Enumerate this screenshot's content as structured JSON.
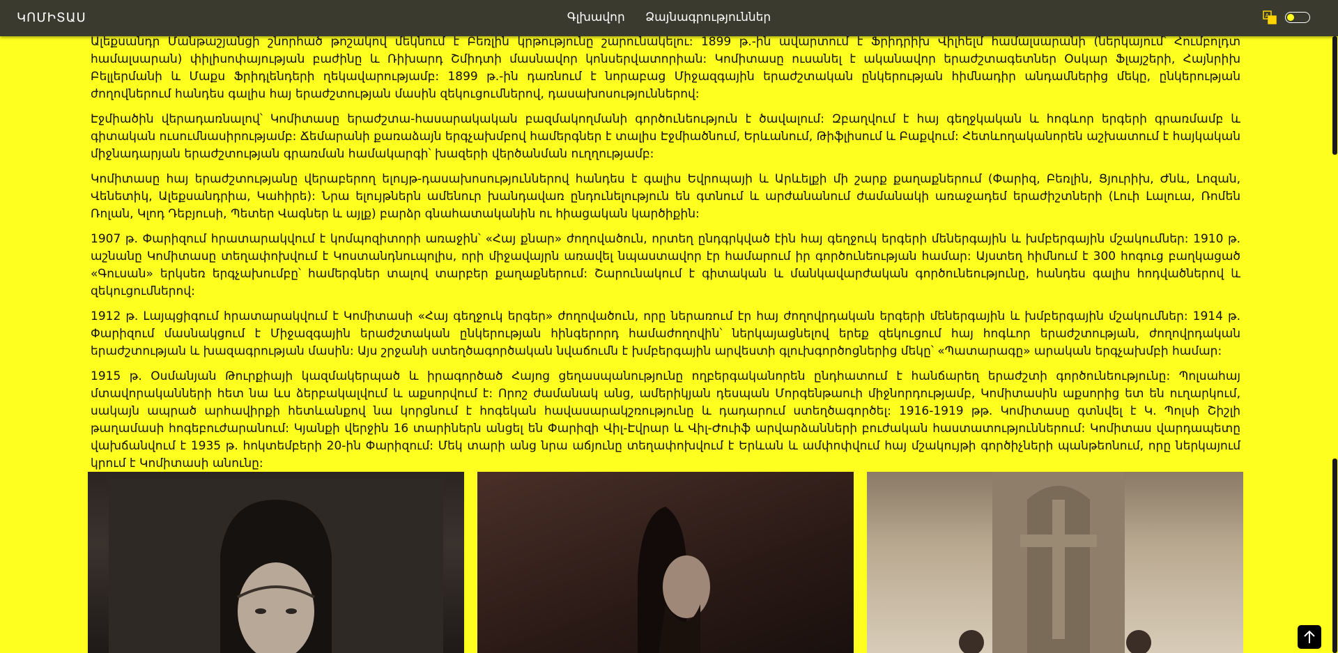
{
  "navbar": {
    "brand": "ԿՈՄԻՏԱՍ",
    "links": [
      "Գլխավոր",
      "Ձայնագրություններ"
    ],
    "translate_icon": "translate-icon",
    "theme_toggle_icon": "toggle-switch"
  },
  "paragraphs": [
    "Ալեքսանդր Մանթաշյանցի շնորհած թոշակով մեկնում է Բեռլին կրթությունը շարունակելու: 1899 թ.-ին ավարտում է Ֆրիդրիխ Վիլհելմ համալսարանի (ներկայում՝ Հումբոլդտ համալսարան) փիլիսոփայության բաժինը և Ռիխարդ Շմիդտի մասնավոր կոնսերվատորիան: Կոմիտասը ուսանել է ականավոր երաժշտագետներ Օսկար Ֆլայշերի, Հայնրիխ Բելլերմանի և Մաքս Ֆրիդլենդերի ղեկավարությամբ: 1899 թ.-ին դառնում է նորաբաց Միջազգային երաժշտական ընկերության հիմնադիր անդամներից մեկը, ընկերության ժողովներում հանդես գալիս հայ երաժշտության մասին զեկուցումներով, դասախոսություններով:",
    "Էջմիածին վերադառնալով՝ Կոմիտասը երաժշտա-հասարակական բազմակողմանի գործունեություն է ծավալում: Զբաղվում է հայ գեղջկական և հոգևոր երգերի գրառմամբ և գիտական ուսումնասիրությամբ: Ճեմարանի քառաձայն երգչախմբով համերգներ է տալիս Էջմիածնում, Երևանում, Թիֆլիսում և Բաքվում: Հետևողականորեն աշխատում է հայկական միջնադարյան երաժշտության գրառման համակարգի՝ խազերի վերծանման ուղղությամբ:",
    "Կոմիտասը հայ երաժշտությանը վերաբերող ելույթ-դասախոսություններով հանդես է գալիս Եվրոպայի և Արևելքի մի շարք քաղաքներում (Փարիզ, Բեռլին, Ցյուրիխ, Ժնև, Լոզան, Վենետիկ, Ալեքսանդրիա, Կահիրե): Նրա ելույթներն ամենուր խանդավառ ընդունելություն են գտնում և արժանանում ժամանակի առաջադեմ երաժիշտների (Լուի Լալուա, Ռոմեն Ռոլան, Կլոդ Դեբյուսի, Պետեր Վագներ և այլք) բարձր գնահատականին ու հիացական կարծիքին:",
    "1907 թ. Փարիզում հրատարակվում է կոմպոզիտորի առաջին՝ «Հայ քնար» ժողովածուն, որտեղ ընդգրկված էին հայ գեղջուկ երգերի մեներգային և խմբերգային մշակումներ: 1910 թ. աշնանը Կոմիտասը տեղափոխվում է Կոստանդնուպոլիս, որի միջավայրն առավել նպաստավոր էր համարում իր գործունեության համար: Այստեղ հիմնում է 300 հոգուց բաղկացած «Գուսան» երկսեռ երգչախումբը՝ համերգներ տալով տարբեր քաղաքներում: Շարունակում է գիտական և մանկավարժական գործունեությունը, հանդես գալիս հոդվածներով և զեկուցումներով:",
    "1912 թ. Լայպցիգում հրատարակվում է Կոմիտասի «Հայ գեղջուկ երգեր» ժողովածուն, որը ներառում էր հայ ժողովրդական երգերի մեներգային և խմբերգային մշակումներ: 1914 թ. Փարիզում մասնակցում է Միջազգային երաժշտական ընկերության հինգերորդ համաժողովին՝ ներկայացնելով երեք զեկուցում հայ հոգևոր երաժշտության, ժողովրդական երաժշտության և խազագրության մասին: Այս շրջանի ստեղծագործական նվաճումն է խմբերգային արվեստի գլուխգործոցներից մեկը՝ «Պատարագը» արական երգչախմբի համար:",
    "1915 թ. Օսմանյան Թուրքիայի կազմակերպած և իրագործած Հայոց ցեղասպանությունը ողբերգականորեն ընդհատում է հանճարեղ երաժշտի գործունեությունը: Պոլսահայ մտավորականների հետ նա ևս ձերբակալվում և աքսորվում է: Որոշ ժամանակ անց, ամերիկյան դեսպան Մորգենթաուի միջնորդությամբ, Կոմիտասին աքսորից ետ են ուղարկում, սակայն ապրած արհավիրքի հետևանքով նա կորցնում է հոգեկան հավասարակշռությունը և դադարում ստեղծագործել: 1916-1919 թթ. Կոմիտասը գտնվել է Կ. Պոլսի Շիշլի թաղամասի հոգեբուժարանում: Կյանքի վերջին 16 տարիներն անցել են Փարիզի Վիլ-Էվրար և Վիլ-Ժուիֆ արվարձանների բուժական հաստատություններում: Կոմիտաս վարդապետը վախճանվում է 1935 թ. հոկտեմբերի 20-ին Փարիզում: Մեկ տարի անց նրա աճյունը տեղափոխվում է Երևան և ամփոփվում հայ մշակույթի գործիչների պանթեոնում, որը ներկայում կրում է Կոմիտասի անունը:"
  ],
  "gallery": [
    "photo-portrait",
    "photo-profile",
    "photo-khachkar"
  ],
  "back_to_top_icon": "arrow-up-icon",
  "colors": {
    "background": "#ffff1f",
    "navbar": "#3b3a2e"
  }
}
